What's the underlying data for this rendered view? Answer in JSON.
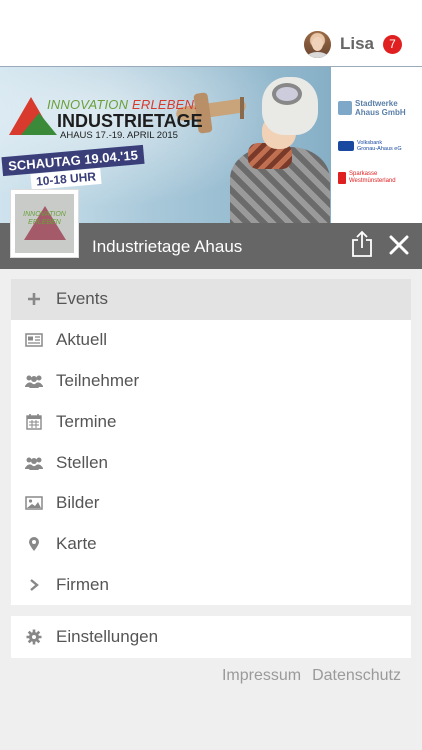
{
  "header": {
    "username": "Lisa",
    "notification_count": "7"
  },
  "banner": {
    "tagline_part1": "INNOVATION",
    "tagline_part2": "ERLEBEN.",
    "headline": "INDUSTRIETAGE",
    "subline": "AHAUS 17.-19. APRIL 2015",
    "schautag": "SCHAUTAG 19.04.'15",
    "hours": "10-18 UHR",
    "sponsors": [
      {
        "line1": "Stadtwerke",
        "line2": "Ahaus GmbH"
      },
      {
        "line1": "Volksbank",
        "line2": "Gronau-Ahaus eG"
      },
      {
        "line1": "Sparkasse",
        "line2": "Westmünsterland"
      }
    ],
    "thumb_line1": "INNOVATION",
    "thumb_line2": "ERLEBEN"
  },
  "event": {
    "title": "Industrietage Ahaus"
  },
  "menu": {
    "items": [
      {
        "label": "Events",
        "icon": "plus-icon"
      },
      {
        "label": "Aktuell",
        "icon": "newspaper-icon"
      },
      {
        "label": "Teilnehmer",
        "icon": "users-icon"
      },
      {
        "label": "Termine",
        "icon": "calendar-icon"
      },
      {
        "label": "Stellen",
        "icon": "users-icon"
      },
      {
        "label": "Bilder",
        "icon": "image-icon"
      },
      {
        "label": "Karte",
        "icon": "map-pin-icon"
      },
      {
        "label": "Firmen",
        "icon": "chevron-right-icon"
      }
    ],
    "settings_label": "Einstellungen"
  },
  "footer": {
    "impressum": "Impressum",
    "datenschutz": "Datenschutz"
  },
  "colors": {
    "badge": "#e02020",
    "event_bar": "#666666",
    "active_row": "#e3e3e3"
  }
}
